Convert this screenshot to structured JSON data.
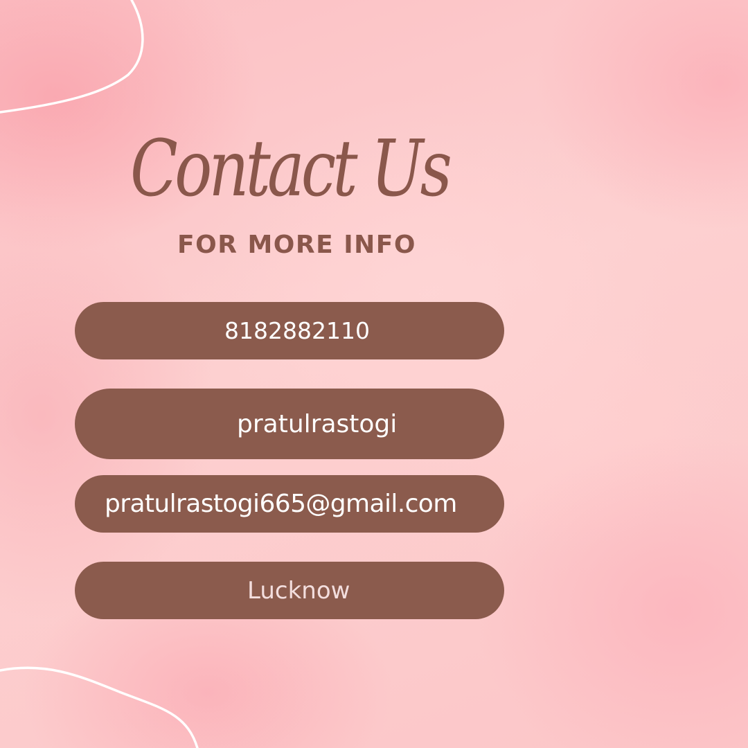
{
  "title": "Contact Us",
  "subtitle": "FOR MORE INFO",
  "contacts": {
    "phone": "8182882110",
    "username": "pratulrastogi",
    "email": "pratulrastogi665@gmail.com",
    "location": "Lucknow"
  },
  "colors": {
    "background": "#fcc8c8",
    "accent_brown": "#8b5b4d",
    "title_brown": "#8a574b",
    "pill_text": "#ffffff",
    "curve_line": "#ffffff"
  }
}
